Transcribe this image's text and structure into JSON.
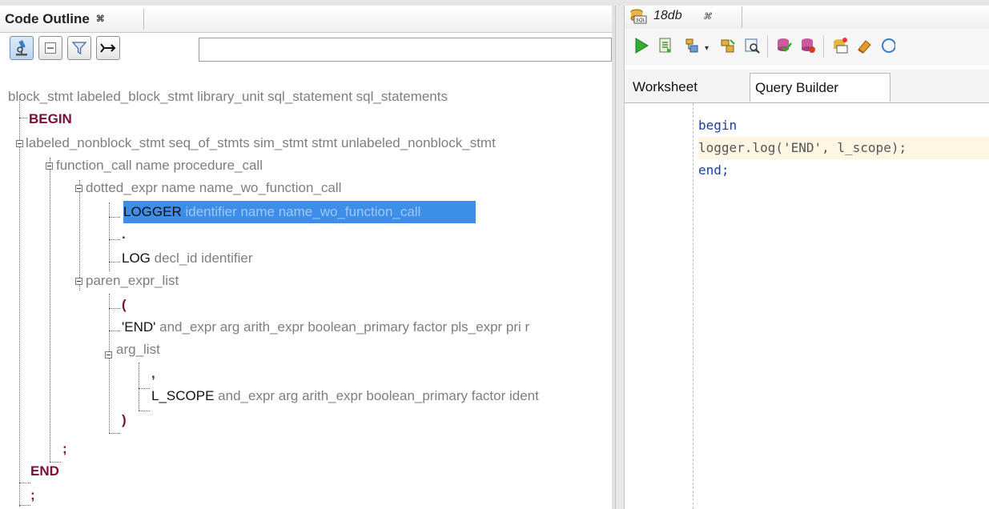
{
  "left_panel": {
    "tab_title": "Code Outline",
    "tab_close": "⌘",
    "filter_placeholder": "",
    "tree": {
      "root": "block_stmt labeled_block_stmt library_unit sql_statement sql_statements",
      "begin": "BEGIN",
      "labeled": "labeled_nonblock_stmt seq_of_stmts sim_stmt stmt unlabeled_nonblock_stmt",
      "function_call": "function_call name procedure_call",
      "dotted_expr": "dotted_expr name name_wo_function_call",
      "logger_token": "LOGGER",
      "logger_desc": "identifier name name_wo_function_call",
      "dot_token": ".",
      "log_token": "LOG",
      "log_desc": "decl_id identifier",
      "paren_expr_list": "paren_expr_list",
      "lparen_token": "(",
      "end_str_token": "'END'",
      "end_str_desc": "and_expr arg arith_expr boolean_primary factor pls_expr pri r",
      "arg_list": "arg_list",
      "comma_token": ",",
      "lscope_token": "L_SCOPE",
      "lscope_desc": "and_expr arg arith_expr boolean_primary factor ident",
      "rparen_token": ")",
      "semicolon_token": ";",
      "end_token": "END",
      "final_token": ";"
    }
  },
  "right_panel": {
    "tab_title": "18db",
    "tab_close": "⌘",
    "subtabs": [
      "Worksheet",
      "Query Builder"
    ],
    "code_lines": [
      "begin",
      "logger.log('END', l_scope);",
      "end;"
    ]
  },
  "colors": {
    "selection": "#3d8ee8",
    "token": "#7a0e36",
    "keyword": "#1a3ea4"
  }
}
